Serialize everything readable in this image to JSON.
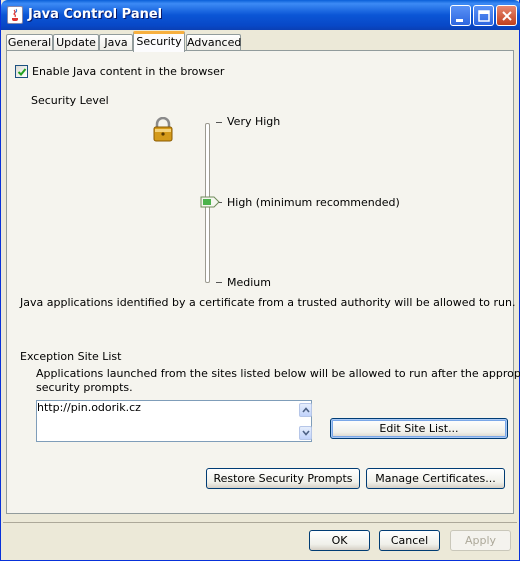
{
  "window": {
    "title": "Java Control Panel",
    "colors": {
      "titlebar": "#0b56d6",
      "active_tab_accent": "#f7b040",
      "background": "#ece9d8"
    }
  },
  "tabs": [
    {
      "label": "General",
      "active": false
    },
    {
      "label": "Update",
      "active": false
    },
    {
      "label": "Java",
      "active": false
    },
    {
      "label": "Security",
      "active": true
    },
    {
      "label": "Advanced",
      "active": false
    }
  ],
  "security": {
    "enable_checkbox": {
      "label": "Enable Java content in the browser",
      "checked": true
    },
    "level_heading": "Security Level",
    "levels": [
      "Very High",
      "High (minimum recommended)",
      "Medium"
    ],
    "selected_level": "High (minimum recommended)",
    "description": "Java applications identified by a certificate from a trusted authority will be allowed to run.",
    "exception": {
      "heading": "Exception Site List",
      "text_line1": "Applications launched from the sites listed below will be allowed to run after the appropriate",
      "text_line2": "security prompts.",
      "sites": [
        "http://pin.odorik.cz"
      ],
      "edit_button": "Edit Site List..."
    },
    "restore_button": "Restore Security Prompts",
    "manage_button": "Manage Certificates..."
  },
  "footer": {
    "ok": "OK",
    "cancel": "Cancel",
    "apply": "Apply"
  },
  "icons": {
    "app": "java-cup-icon",
    "lock": "padlock-icon"
  }
}
